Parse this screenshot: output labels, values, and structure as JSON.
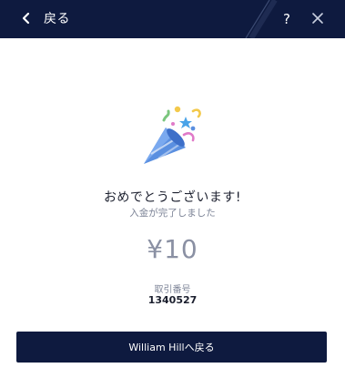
{
  "header": {
    "back_label": "戻る",
    "help_label": "?"
  },
  "message": {
    "title": "おめでとうございます!",
    "subtitle": "入金が完了しました"
  },
  "deposit": {
    "amount": "¥10",
    "transaction_label": "取引番号",
    "transaction_number": "1340527"
  },
  "footer": {
    "return_button_label": "William Hillへ戻る"
  },
  "colors": {
    "header_bg": "#0e1a3f",
    "button_bg": "#0e1a3f",
    "accent_blue": "#5a8fe0"
  },
  "icons": {
    "back": "chevron-left-icon",
    "help": "question-mark-icon",
    "close": "close-icon",
    "celebration": "party-popper-icon"
  }
}
